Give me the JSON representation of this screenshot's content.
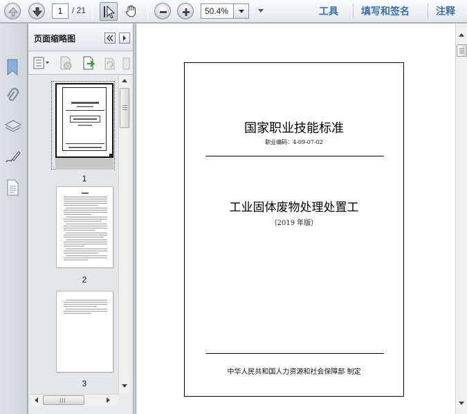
{
  "toolbar": {
    "current_page": "1",
    "total_pages": "/ 21",
    "zoom_value": "50.4%",
    "links": [
      "工具",
      "填写和签名",
      "注释"
    ]
  },
  "panel": {
    "title": "页面缩略图",
    "thumbnails": [
      {
        "number": "1",
        "selected": true
      },
      {
        "number": "2",
        "selected": false
      },
      {
        "number": "3",
        "selected": false
      }
    ]
  },
  "document": {
    "title": "国家职业技能标准",
    "code": "职业编码：4-09-07-02",
    "main_title": "工业固体废物处理处置工",
    "edition": "（2019 年版）",
    "issuer": "中华人民共和国人力资源和社会保障部 制定"
  },
  "colors": {
    "accent_link": "#3c70a4",
    "rail_icon": "#7d96b4"
  }
}
